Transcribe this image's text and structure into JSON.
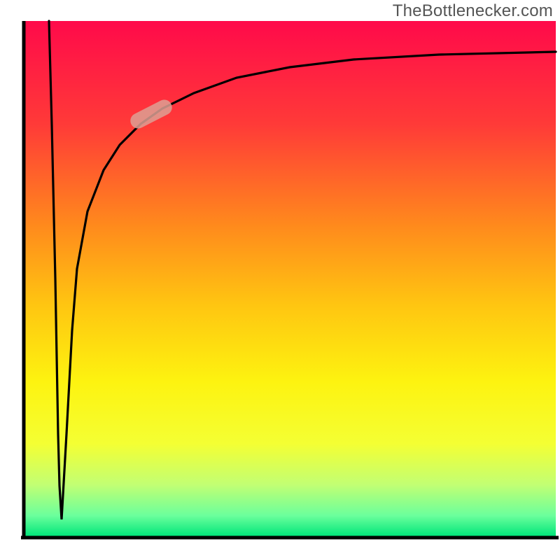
{
  "watermark": "TheBottlenecker.com",
  "chart_data": {
    "type": "line",
    "title": "",
    "xlabel": "",
    "ylabel": "",
    "xlim": [
      0,
      100
    ],
    "ylim": [
      0,
      100
    ],
    "annotations": [
      {
        "name": "marker",
        "x": 26,
        "y": 83
      }
    ],
    "background_gradient": {
      "direction": "vertical",
      "stops": [
        {
          "pos": 0.0,
          "color": "#ff0a4a"
        },
        {
          "pos": 0.2,
          "color": "#ff3a38"
        },
        {
          "pos": 0.4,
          "color": "#ff8b1c"
        },
        {
          "pos": 0.55,
          "color": "#ffc511"
        },
        {
          "pos": 0.7,
          "color": "#fdf310"
        },
        {
          "pos": 0.82,
          "color": "#f4ff33"
        },
        {
          "pos": 0.9,
          "color": "#c2ff73"
        },
        {
          "pos": 0.96,
          "color": "#6bff9c"
        },
        {
          "pos": 1.0,
          "color": "#00e57a"
        }
      ]
    },
    "series": [
      {
        "name": "down-stroke",
        "x": [
          4.8,
          5.4,
          6.0,
          6.3,
          6.6,
          6.9,
          7.2
        ],
        "y": [
          100,
          80,
          50,
          35,
          20,
          10,
          3.5
        ],
        "note": "nearly vertical black line descending along left edge"
      },
      {
        "name": "up-curve",
        "x": [
          7.2,
          8,
          9,
          10,
          12,
          15,
          18,
          22,
          26,
          32,
          40,
          50,
          62,
          78,
          100
        ],
        "y": [
          3.5,
          20,
          40,
          52,
          63,
          71,
          76,
          80,
          83,
          86,
          89,
          91,
          92.5,
          93.5,
          94
        ],
        "note": "logarithmic-like rise toward upper right"
      }
    ]
  }
}
